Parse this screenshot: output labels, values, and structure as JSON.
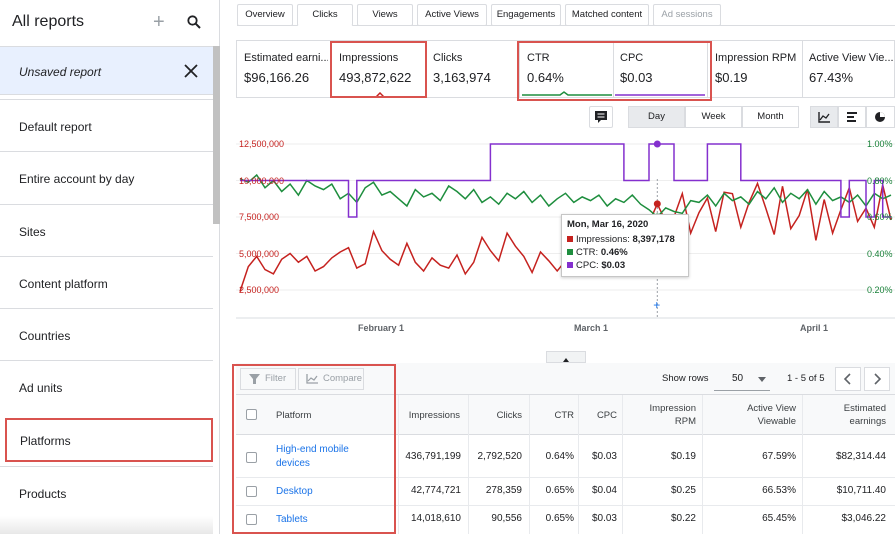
{
  "sidebar": {
    "title": "All reports",
    "unsaved": "Unsaved report",
    "items": [
      {
        "label": "Default report"
      },
      {
        "label": "Entire account by day"
      },
      {
        "label": "Sites"
      },
      {
        "label": "Content platform"
      },
      {
        "label": "Countries"
      },
      {
        "label": "Ad units"
      },
      {
        "label": "Platforms",
        "selected": true
      },
      {
        "label": "Products"
      }
    ]
  },
  "tabs": [
    {
      "label": "Overview"
    },
    {
      "label": "Clicks",
      "active": true
    },
    {
      "label": "Views"
    },
    {
      "label": "Active Views"
    },
    {
      "label": "Engagements"
    },
    {
      "label": "Matched content"
    },
    {
      "label": "Ad sessions",
      "disabled": true
    }
  ],
  "metrics": [
    {
      "label": "Estimated earni...",
      "value": "$96,166.26"
    },
    {
      "label": "Impressions",
      "value": "493,872,622"
    },
    {
      "label": "Clicks",
      "value": "3,163,974"
    },
    {
      "label": "CTR",
      "value": "0.64%"
    },
    {
      "label": "CPC",
      "value": "$0.03"
    },
    {
      "label": "Impression RPM",
      "value": "$0.19"
    },
    {
      "label": "Active View Vie...",
      "value": "67.43%"
    }
  ],
  "granularity": {
    "day": "Day",
    "week": "Week",
    "month": "Month",
    "selected": "Day"
  },
  "colors": {
    "impressions": "#c5221f",
    "ctr": "#1e8e3e",
    "cpc": "#8430ce",
    "highlight": "#d9534f"
  },
  "chart_data": {
    "type": "line",
    "left_axis": {
      "ticks": [
        "12,500,000",
        "10,000,000",
        "7,500,000",
        "5,000,000",
        "2,500,000"
      ]
    },
    "right_axis": {
      "ticks": [
        "1.00%",
        "0.80%",
        "0.60%",
        "0.40%",
        "0.20%"
      ]
    },
    "x_ticks": [
      "February 1",
      "March 1",
      "April 1"
    ],
    "series": [
      {
        "name": "Impressions",
        "color": "#c5221f",
        "values": [
          2.4,
          4.1,
          4.8,
          3.9,
          3.6,
          4.6,
          5.0,
          4.4,
          4.8,
          3.8,
          4.1,
          4.7,
          5.1,
          5.4,
          4.0,
          4.3,
          6.5,
          5.2,
          4.6,
          4.2,
          5.7,
          4.4,
          3.8,
          4.7,
          4.2,
          4.0,
          4.9,
          3.6,
          4.4,
          6.1,
          5.2,
          4.5,
          6.4,
          5.5,
          4.8,
          3.7,
          5.1,
          4.5,
          3.8,
          4.5,
          5.3,
          4.4,
          3.6,
          4.9,
          4.2,
          4.4,
          5.2,
          4.5,
          6.2,
          7.1,
          8.4,
          7.2,
          7.5,
          9.1,
          6.4,
          7.8,
          8.8,
          6.5,
          9.2,
          9.1,
          6.8,
          8.5,
          9.8,
          8.1,
          6.3,
          9.6,
          6.7,
          7.6,
          9.4,
          5.9,
          8.7,
          6.4,
          8.0,
          9.5,
          7.2,
          8.1,
          6.8,
          9.7,
          7.3
        ]
      },
      {
        "name": "CTR",
        "color": "#1e8e3e",
        "values": [
          0.81,
          0.79,
          0.83,
          0.76,
          0.8,
          0.74,
          0.78,
          0.72,
          0.8,
          0.77,
          0.75,
          0.78,
          0.7,
          0.73,
          0.68,
          0.76,
          0.79,
          0.72,
          0.74,
          0.7,
          0.66,
          0.75,
          0.71,
          0.73,
          0.69,
          0.77,
          0.74,
          0.7,
          0.75,
          0.68,
          0.71,
          0.67,
          0.73,
          0.7,
          0.74,
          0.68,
          0.72,
          0.66,
          0.7,
          0.73,
          0.68,
          0.71,
          0.69,
          0.72,
          0.66,
          0.7,
          0.68,
          0.72,
          0.67,
          0.64,
          0.6,
          0.65,
          0.63,
          0.62,
          0.69,
          0.68,
          0.72,
          0.66,
          0.73,
          0.69,
          0.71,
          0.67,
          0.74,
          0.7,
          0.76,
          0.68,
          0.73,
          0.7,
          0.75,
          0.67,
          0.74,
          0.69,
          0.71,
          0.68,
          0.72,
          0.66,
          0.73,
          0.7,
          0.72
        ]
      },
      {
        "name": "CPC",
        "color": "#8430ce",
        "values": [
          0.8,
          0.8,
          0.8,
          0.8,
          0.8,
          0.8,
          0.8,
          0.8,
          0.8,
          0.8,
          0.8,
          0.8,
          0.8,
          0.6,
          0.8,
          0.8,
          0.8,
          0.8,
          0.8,
          0.8,
          0.8,
          0.8,
          0.8,
          0.8,
          0.8,
          0.8,
          0.8,
          0.8,
          0.8,
          0.8,
          1.0,
          1.0,
          1.0,
          1.0,
          1.0,
          1.0,
          1.0,
          1.0,
          1.0,
          1.0,
          1.0,
          1.0,
          1.0,
          1.0,
          1.0,
          1.0,
          0.8,
          0.8,
          0.8,
          1.0,
          1.0,
          1.0,
          0.8,
          0.8,
          0.8,
          0.8,
          1.0,
          1.0,
          1.0,
          1.0,
          0.8,
          0.8,
          0.8,
          0.8,
          0.8,
          0.8,
          0.8,
          0.8,
          0.8,
          0.8,
          0.8,
          0.8,
          0.6,
          0.8,
          0.8,
          0.6,
          0.8,
          0.6,
          0.6
        ]
      }
    ],
    "tooltip": {
      "date": "Mon, Mar 16, 2020",
      "impressions_label": "Impressions:",
      "impressions": "8,397,178",
      "ctr_label": "CTR:",
      "ctr": "0.46%",
      "cpc_label": "CPC:",
      "cpc": "$0.03"
    }
  },
  "toolbar": {
    "filter": "Filter",
    "compare": "Compare",
    "show_rows": "Show rows",
    "rows_value": "50",
    "range": "1 - 5 of 5"
  },
  "table": {
    "headers": [
      "Platform",
      "Impressions",
      "Clicks",
      "CTR",
      "CPC",
      "Impression RPM",
      "Active View Viewable",
      "Estimated earnings"
    ],
    "rows": [
      {
        "platform": "High-end mobile devices",
        "impressions": "436,791,199",
        "clicks": "2,792,520",
        "ctr": "0.64%",
        "cpc": "$0.03",
        "rpm": "$0.19",
        "viewable": "67.59%",
        "earnings": "$82,314.44"
      },
      {
        "platform": "Desktop",
        "impressions": "42,774,721",
        "clicks": "278,359",
        "ctr": "0.65%",
        "cpc": "$0.04",
        "rpm": "$0.25",
        "viewable": "66.53%",
        "earnings": "$10,711.40"
      },
      {
        "platform": "Tablets",
        "impressions": "14,018,610",
        "clicks": "90,556",
        "ctr": "0.65%",
        "cpc": "$0.03",
        "rpm": "$0.22",
        "viewable": "65.45%",
        "earnings": "$3,046.22"
      }
    ]
  }
}
